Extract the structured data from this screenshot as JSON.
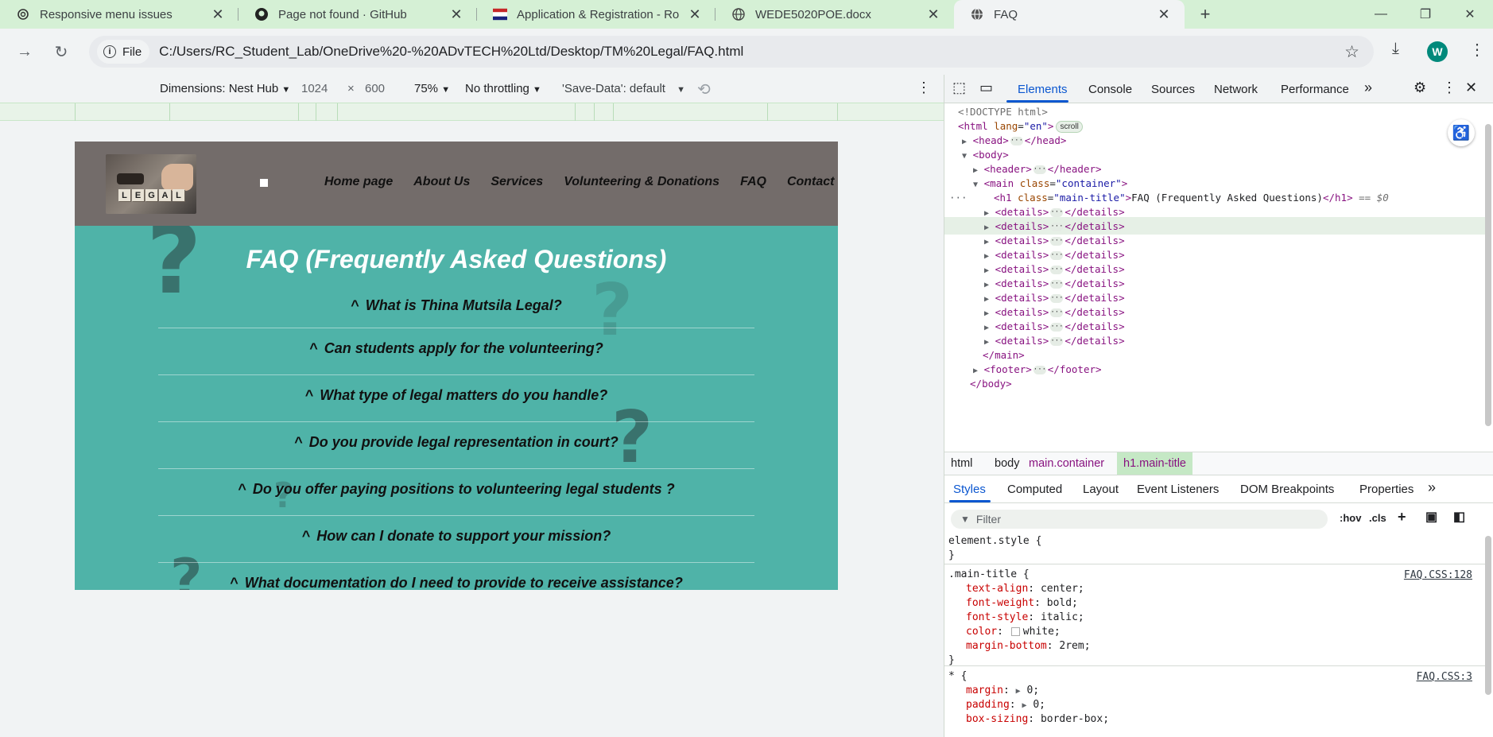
{
  "browser": {
    "tabs": [
      {
        "title": "Responsive menu issues",
        "icon": "openai-icon"
      },
      {
        "title": "Page not found · GitHub",
        "icon": "github-icon"
      },
      {
        "title": "Application & Registration - Ro",
        "icon": "flag-icon"
      },
      {
        "title": "WEDE5020POE.docx",
        "icon": "globe-icon"
      },
      {
        "title": "FAQ",
        "icon": "globe-icon"
      }
    ],
    "chip_label": "File",
    "url": "C:/Users/RC_Student_Lab/OneDrive%20-%20ADvTECH%20Ltd/Desktop/TM%20Legal/FAQ.html",
    "avatar_letter": "W"
  },
  "device_toolbar": {
    "dimensions_label": "Dimensions: Nest Hub",
    "width": "1024",
    "times": "×",
    "height": "600",
    "zoom": "75%",
    "throttle": "No throttling",
    "save_data": "'Save-Data': default"
  },
  "site": {
    "logo_letters": [
      "L",
      "E",
      "G",
      "A",
      "L"
    ],
    "nav": [
      "Home page",
      "About Us",
      "Services",
      "Volunteering & Donations",
      "FAQ",
      "Contact Us"
    ],
    "title": "FAQ (Frequently Asked Questions)",
    "caret": "^",
    "questions": [
      "What is Thina Mutsila Legal?",
      "Can students apply for the volunteering?",
      "What type of legal matters do you handle?",
      "Do you provide legal representation in court?",
      "Do you offer paying positions to volunteering legal students ?",
      "How can I donate to support your mission?",
      "What documentation do I need to provide to receive assistance?"
    ]
  },
  "devtools": {
    "tabs": [
      "Elements",
      "Console",
      "Sources",
      "Network",
      "Performance"
    ],
    "dom": {
      "doctype": "<!DOCTYPE html>",
      "html_open": "<html",
      "lang_attr": "lang",
      "lang_val": "\"en\"",
      "scroll_badge": "scroll",
      "head": "head",
      "body": "body",
      "header": "header",
      "main": "main",
      "main_class_attr": "class",
      "main_class_val": "\"container\"",
      "h1": "h1",
      "h1_class_val": "\"main-title\"",
      "h1_text": "FAQ (Frequently Asked Questions)",
      "eq": "== $0",
      "details": "details",
      "footer": "footer"
    },
    "breadcrumbs": [
      "html",
      "body",
      "main.container",
      "h1.main-title"
    ],
    "subtabs": [
      "Styles",
      "Computed",
      "Layout",
      "Event Listeners",
      "DOM Breakpoints",
      "Properties"
    ],
    "filter_placeholder": "Filter",
    "hov": ":hov",
    "cls": ".cls",
    "rules": {
      "element_style": "element.style {",
      "close": "}",
      "main_title_selector": ".main-title {",
      "main_title_src": "FAQ.CSS:128",
      "main_title_props": [
        {
          "name": "text-align",
          "value": "center;"
        },
        {
          "name": "font-weight",
          "value": "bold;"
        },
        {
          "name": "font-style",
          "value": "italic;"
        },
        {
          "name": "color",
          "value": "white;"
        },
        {
          "name": "margin-bottom",
          "value": "2rem;"
        }
      ],
      "star_selector": "* {",
      "star_src": "FAQ.CSS:3",
      "star_props": [
        {
          "name": "margin",
          "value": "0;"
        },
        {
          "name": "padding",
          "value": "0;"
        },
        {
          "name": "box-sizing",
          "value": "border-box;"
        }
      ]
    }
  }
}
